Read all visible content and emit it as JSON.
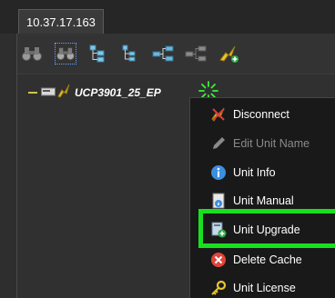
{
  "tab": {
    "title": "10.37.17.163"
  },
  "toolbar": {
    "icons": [
      "binoculars-icon",
      "binoculars-selected-icon",
      "tree-expand-icon",
      "tree-collapse-icon",
      "network-icon",
      "network-disconnected-icon",
      "add-unit-icon"
    ]
  },
  "tree": {
    "unit_label": "UCP3901_25_EP"
  },
  "menu": {
    "items": [
      {
        "label": "Disconnect",
        "icon": "disconnect-icon",
        "enabled": true
      },
      {
        "label": "Edit Unit Name",
        "icon": "pencil-icon",
        "enabled": false
      },
      {
        "label": "Unit Info",
        "icon": "info-icon",
        "enabled": true
      },
      {
        "label": "Unit Manual",
        "icon": "manual-icon",
        "enabled": true
      },
      {
        "label": "Unit Upgrade",
        "icon": "upgrade-icon",
        "enabled": true
      },
      {
        "label": "Delete Cache",
        "icon": "delete-icon",
        "enabled": true
      },
      {
        "label": "Unit License",
        "icon": "license-icon",
        "enabled": true
      }
    ]
  },
  "colors": {
    "highlight": "#19e01f",
    "menu_bg": "#191919",
    "accent_yellow": "#e8c52a"
  }
}
